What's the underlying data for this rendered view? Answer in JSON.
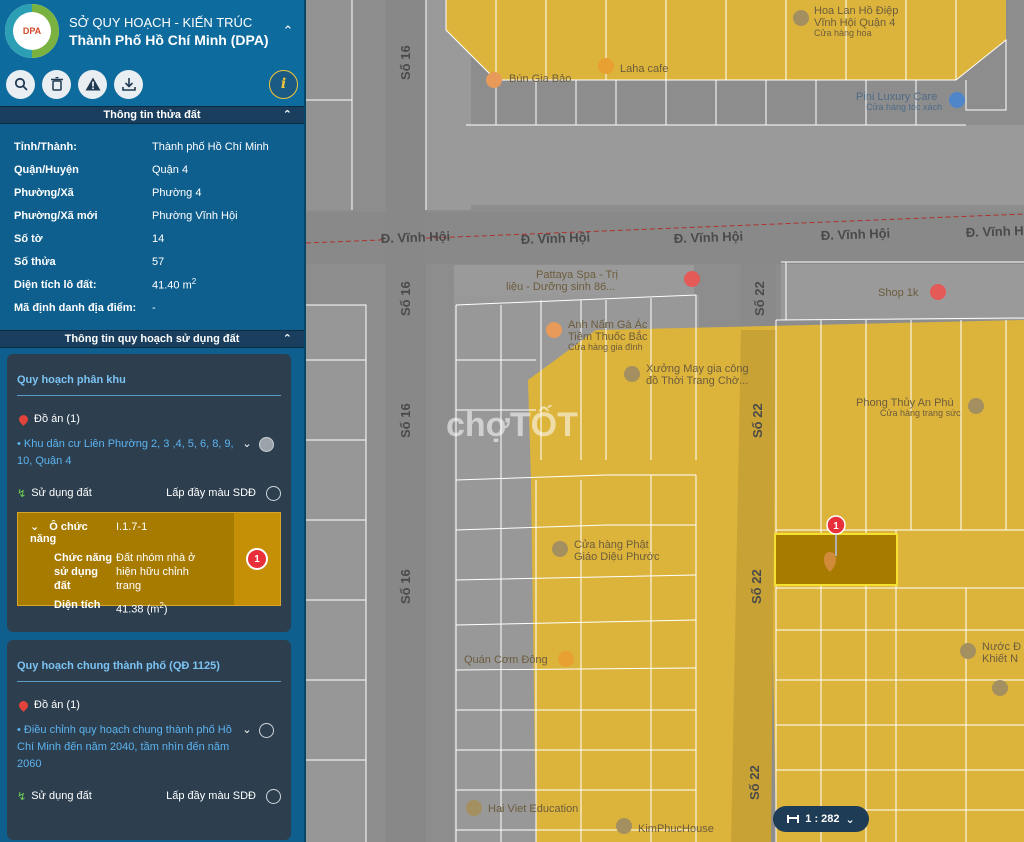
{
  "header": {
    "org_line1": "SỞ QUY HOẠCH - KIẾN TRÚC",
    "org_line2": "Thành Phố Hồ Chí Minh (DPA)",
    "collapse_icon": "chevron-up-icon",
    "logo_text": "DPA"
  },
  "toolbar": {
    "buttons": [
      {
        "name": "search-icon"
      },
      {
        "name": "trash-icon"
      },
      {
        "name": "warning-icon"
      },
      {
        "name": "download-icon"
      },
      {
        "name": "info-icon"
      }
    ]
  },
  "parcel_info": {
    "title": "Thông tin thửa đất",
    "rows": [
      {
        "label": "Tỉnh/Thành:",
        "value": "Thành phố Hồ Chí Minh"
      },
      {
        "label": "Quận/Huyện",
        "value": "Quận 4"
      },
      {
        "label": "Phường/Xã",
        "value": "Phường 4"
      },
      {
        "label": "Phường/Xã mới",
        "value": "Phường Vĩnh Hội"
      },
      {
        "label": "Số tờ",
        "value": "14"
      },
      {
        "label": "Số thửa",
        "value": "57"
      },
      {
        "label": "Diện tích lô đất:",
        "value": "41.40 m",
        "unit_sup": "2"
      },
      {
        "label": "Mã định danh địa điểm:",
        "value": "-"
      }
    ]
  },
  "land_use": {
    "title": "Thông tin quy hoạch sử dụng đất",
    "zoning": {
      "title": "Quy hoạch phân khu",
      "project_count_label": "Đồ án (1)",
      "project_link": "• Khu dân cư Liên Phường 2, 3 ,4, 5, 6, 8, 9, 10, Quận 4",
      "land_use_label": "Sử dụng đất",
      "fill_label": "Lấp đầy màu SDĐ",
      "function_box": {
        "cell_label": "Ô chức năng",
        "cell_value": "I.1.7-1",
        "function_label": "Chức năng sử dụng đất",
        "function_value": "Đất nhóm nhà ở hiện hữu chỉnh trang",
        "area_label": "Diện tích",
        "area_value": "41.38 (m",
        "area_sup": "2",
        "area_suffix": ")",
        "badge": "1"
      }
    },
    "general": {
      "title": "Quy hoạch chung thành phố (QĐ 1125)",
      "project_count_label": "Đồ án (1)",
      "project_link": "• Điều chỉnh quy hoạch chung thành phố Hồ Chí Minh đến năm 2040, tầm nhìn đến năm 2060",
      "land_use_label": "Sử dụng đất",
      "fill_label": "Lấp đầy màu SDĐ"
    }
  },
  "map": {
    "roads": [
      "Đ. Vĩnh Hội",
      "Đ. Vĩnh Hội",
      "Đ. Vĩnh Hội",
      "Đ. Vĩnh Hội",
      "Đ. Vĩnh Hội",
      "Số 16",
      "Số 16",
      "Số 16",
      "Số 16",
      "Số 22",
      "Số 22",
      "Số 22",
      "Số 22"
    ],
    "pois": [
      {
        "name": "Hoa Lan Hồ Điệp",
        "sub": "Vĩnh Hội Quận 4",
        "sub2": "Cửa hàng hoa",
        "icon": "lock-icon"
      },
      {
        "name": "Bún Gia Bảo",
        "icon": "restaurant-icon"
      },
      {
        "name": "Laha cafe",
        "icon": "cafe-icon"
      },
      {
        "name": "Pini Luxury Care",
        "sub": "Cửa hàng tóc xách",
        "icon": "shop-icon"
      },
      {
        "name": "Pattaya Spa - Trị",
        "sub": "liệu - Dưỡng sinh 86...",
        "icon": "spa-icon"
      },
      {
        "name": "Shop 1k",
        "icon": "shop-icon"
      },
      {
        "name": "Anh Nấm Gà Ác",
        "sub": "Tiềm Thuốc Bắc",
        "sub2": "Cửa hàng gia đình",
        "icon": "restaurant-icon"
      },
      {
        "name": "Xưởng May gia công",
        "sub": "đồ Thời Trang Chờ...",
        "icon": "pin-icon"
      },
      {
        "name": "Phong Thủy An Phú",
        "sub": "Cửa hàng trang sức",
        "icon": "lock-icon"
      },
      {
        "name": "Cửa hàng Phật",
        "sub": "Giáo Diệu Phước",
        "icon": "lock-icon"
      },
      {
        "name": "Quán Cơm Đông",
        "icon": "restaurant-icon"
      },
      {
        "name": "Nước Đ",
        "sub": "Khiết N",
        "icon": "pin-icon"
      },
      {
        "name": "Hai Viet Education",
        "icon": "pin-icon"
      },
      {
        "name": "KimPhucHouse",
        "icon": "pin-icon"
      }
    ],
    "watermark": "chợTỐT",
    "marker_badge": "1",
    "scale_label": "1 : 282",
    "colors": {
      "parcel_fill": "#dcb43c",
      "road": "#8d8d8d",
      "selected": "#a67b00"
    }
  }
}
